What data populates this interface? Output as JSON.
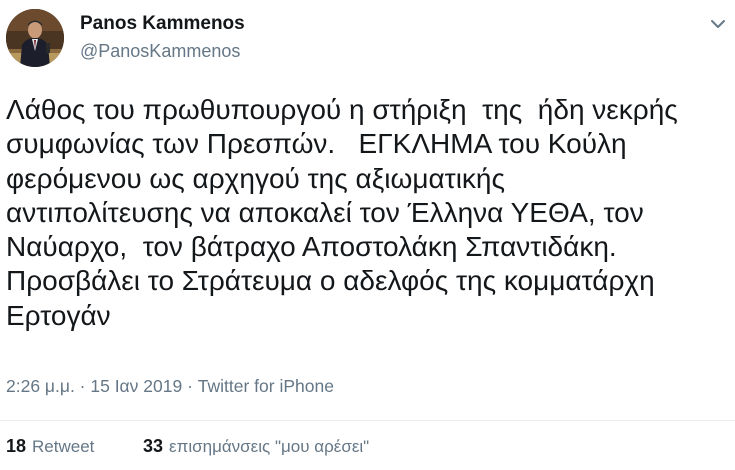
{
  "author": {
    "name": "Panos Kammenos",
    "handle": "@PanosKammenos"
  },
  "tweet": {
    "lines": [
      "Λάθος του πρωθυπουργού η στήριξη  της  ήδη νεκρής",
      "συμφωνίας των Πρεσπών.   ΕΓΚΛΗΜΑ του Κούλη",
      "φερόμενου ως αρχηγού της αξιωματικής",
      "αντιπολίτευσης να αποκαλεί τον Έλληνα ΥΕΘΑ, τον",
      "Ναύαρχο,  τον βάτραχο Αποστολάκη Σπαντιδάκη.",
      "Προσβάλει το Στράτευμα ο αδελφός της κομματάρχη",
      "Ερτογάν"
    ],
    "timestamp": "2:26 μ.μ. · 15 Ιαν 2019 · ",
    "source": "Twitter for iPhone"
  },
  "stats": {
    "retweets_count": "18",
    "retweets_label": "Retweet",
    "likes_count": "33",
    "likes_label": "επισημάνσεις \"μου αρέσει\""
  },
  "icons": {
    "menu": "chevron-down-icon"
  },
  "colors": {
    "text": "#14171a",
    "secondary": "#657786",
    "divider": "#e6ecf0"
  }
}
